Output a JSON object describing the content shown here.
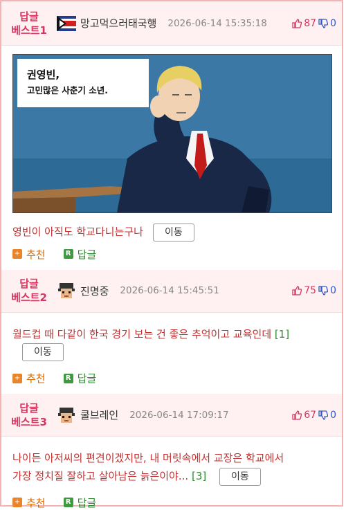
{
  "replies": [
    {
      "rank": [
        "답글",
        "베스트1"
      ],
      "avatar": "flag-avatar",
      "nickname": "망고먹으러태국행",
      "timestamp": "2026-06-14 15:35:18",
      "upvotes": "87",
      "downvotes": "0",
      "image_text": [
        "권영빈,",
        "고민많은 사춘기 소년."
      ],
      "text": "영빈이 아직도 학교다니는구나",
      "reply_count": "",
      "move_label": "이동",
      "recommend_label": "추천",
      "reply_label": "답글"
    },
    {
      "rank": [
        "답글",
        "베스트2"
      ],
      "avatar": "pixel-avatar",
      "nickname": "진명중",
      "timestamp": "2026-06-14 15:45:51",
      "upvotes": "75",
      "downvotes": "0",
      "text": "월드컵 때 다같이 한국 경기 보는 건 좋은 추억이고 교육인데",
      "reply_count": "[1]",
      "move_label": "이동",
      "recommend_label": "추천",
      "reply_label": "답글"
    },
    {
      "rank": [
        "답글",
        "베스트3"
      ],
      "avatar": "pixel-avatar",
      "nickname": "쿨브레인",
      "timestamp": "2026-06-14 17:09:17",
      "upvotes": "67",
      "downvotes": "0",
      "text_lines": [
        "나이든 아저씨의 편견이겠지만, 내 머릿속에서 교장은 학교에서",
        "가장 정치질 잘하고 살아남은 늙은이야..."
      ],
      "reply_count": "[3]",
      "move_label": "이동",
      "recommend_label": "추천",
      "reply_label": "답글"
    }
  ],
  "colors": {
    "accent": "#d8345f",
    "header_bg": "#fff1f1",
    "border": "#f3b3b3",
    "text_red": "#c33030",
    "down_blue": "#2e58c8",
    "reply_green": "#2f8a2f"
  }
}
